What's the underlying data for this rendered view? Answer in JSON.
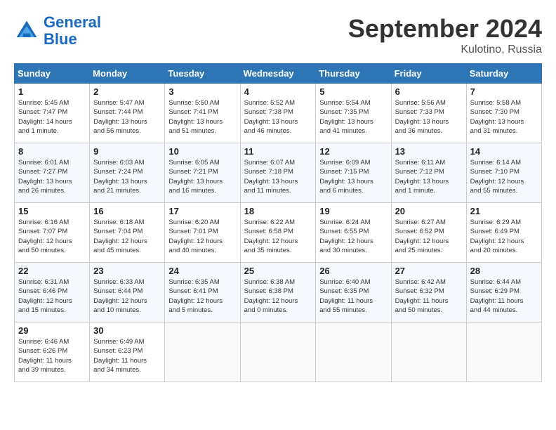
{
  "header": {
    "logo_general": "General",
    "logo_blue": "Blue",
    "month_title": "September 2024",
    "location": "Kulotino, Russia"
  },
  "weekdays": [
    "Sunday",
    "Monday",
    "Tuesday",
    "Wednesday",
    "Thursday",
    "Friday",
    "Saturday"
  ],
  "weeks": [
    [
      {
        "day": "1",
        "info": "Sunrise: 5:45 AM\nSunset: 7:47 PM\nDaylight: 14 hours\nand 1 minute."
      },
      {
        "day": "2",
        "info": "Sunrise: 5:47 AM\nSunset: 7:44 PM\nDaylight: 13 hours\nand 56 minutes."
      },
      {
        "day": "3",
        "info": "Sunrise: 5:50 AM\nSunset: 7:41 PM\nDaylight: 13 hours\nand 51 minutes."
      },
      {
        "day": "4",
        "info": "Sunrise: 5:52 AM\nSunset: 7:38 PM\nDaylight: 13 hours\nand 46 minutes."
      },
      {
        "day": "5",
        "info": "Sunrise: 5:54 AM\nSunset: 7:35 PM\nDaylight: 13 hours\nand 41 minutes."
      },
      {
        "day": "6",
        "info": "Sunrise: 5:56 AM\nSunset: 7:33 PM\nDaylight: 13 hours\nand 36 minutes."
      },
      {
        "day": "7",
        "info": "Sunrise: 5:58 AM\nSunset: 7:30 PM\nDaylight: 13 hours\nand 31 minutes."
      }
    ],
    [
      {
        "day": "8",
        "info": "Sunrise: 6:01 AM\nSunset: 7:27 PM\nDaylight: 13 hours\nand 26 minutes."
      },
      {
        "day": "9",
        "info": "Sunrise: 6:03 AM\nSunset: 7:24 PM\nDaylight: 13 hours\nand 21 minutes."
      },
      {
        "day": "10",
        "info": "Sunrise: 6:05 AM\nSunset: 7:21 PM\nDaylight: 13 hours\nand 16 minutes."
      },
      {
        "day": "11",
        "info": "Sunrise: 6:07 AM\nSunset: 7:18 PM\nDaylight: 13 hours\nand 11 minutes."
      },
      {
        "day": "12",
        "info": "Sunrise: 6:09 AM\nSunset: 7:15 PM\nDaylight: 13 hours\nand 6 minutes."
      },
      {
        "day": "13",
        "info": "Sunrise: 6:11 AM\nSunset: 7:12 PM\nDaylight: 13 hours\nand 1 minute."
      },
      {
        "day": "14",
        "info": "Sunrise: 6:14 AM\nSunset: 7:10 PM\nDaylight: 12 hours\nand 55 minutes."
      }
    ],
    [
      {
        "day": "15",
        "info": "Sunrise: 6:16 AM\nSunset: 7:07 PM\nDaylight: 12 hours\nand 50 minutes."
      },
      {
        "day": "16",
        "info": "Sunrise: 6:18 AM\nSunset: 7:04 PM\nDaylight: 12 hours\nand 45 minutes."
      },
      {
        "day": "17",
        "info": "Sunrise: 6:20 AM\nSunset: 7:01 PM\nDaylight: 12 hours\nand 40 minutes."
      },
      {
        "day": "18",
        "info": "Sunrise: 6:22 AM\nSunset: 6:58 PM\nDaylight: 12 hours\nand 35 minutes."
      },
      {
        "day": "19",
        "info": "Sunrise: 6:24 AM\nSunset: 6:55 PM\nDaylight: 12 hours\nand 30 minutes."
      },
      {
        "day": "20",
        "info": "Sunrise: 6:27 AM\nSunset: 6:52 PM\nDaylight: 12 hours\nand 25 minutes."
      },
      {
        "day": "21",
        "info": "Sunrise: 6:29 AM\nSunset: 6:49 PM\nDaylight: 12 hours\nand 20 minutes."
      }
    ],
    [
      {
        "day": "22",
        "info": "Sunrise: 6:31 AM\nSunset: 6:46 PM\nDaylight: 12 hours\nand 15 minutes."
      },
      {
        "day": "23",
        "info": "Sunrise: 6:33 AM\nSunset: 6:44 PM\nDaylight: 12 hours\nand 10 minutes."
      },
      {
        "day": "24",
        "info": "Sunrise: 6:35 AM\nSunset: 6:41 PM\nDaylight: 12 hours\nand 5 minutes."
      },
      {
        "day": "25",
        "info": "Sunrise: 6:38 AM\nSunset: 6:38 PM\nDaylight: 12 hours\nand 0 minutes."
      },
      {
        "day": "26",
        "info": "Sunrise: 6:40 AM\nSunset: 6:35 PM\nDaylight: 11 hours\nand 55 minutes."
      },
      {
        "day": "27",
        "info": "Sunrise: 6:42 AM\nSunset: 6:32 PM\nDaylight: 11 hours\nand 50 minutes."
      },
      {
        "day": "28",
        "info": "Sunrise: 6:44 AM\nSunset: 6:29 PM\nDaylight: 11 hours\nand 44 minutes."
      }
    ],
    [
      {
        "day": "29",
        "info": "Sunrise: 6:46 AM\nSunset: 6:26 PM\nDaylight: 11 hours\nand 39 minutes."
      },
      {
        "day": "30",
        "info": "Sunrise: 6:49 AM\nSunset: 6:23 PM\nDaylight: 11 hours\nand 34 minutes."
      },
      {
        "day": "",
        "info": ""
      },
      {
        "day": "",
        "info": ""
      },
      {
        "day": "",
        "info": ""
      },
      {
        "day": "",
        "info": ""
      },
      {
        "day": "",
        "info": ""
      }
    ]
  ]
}
